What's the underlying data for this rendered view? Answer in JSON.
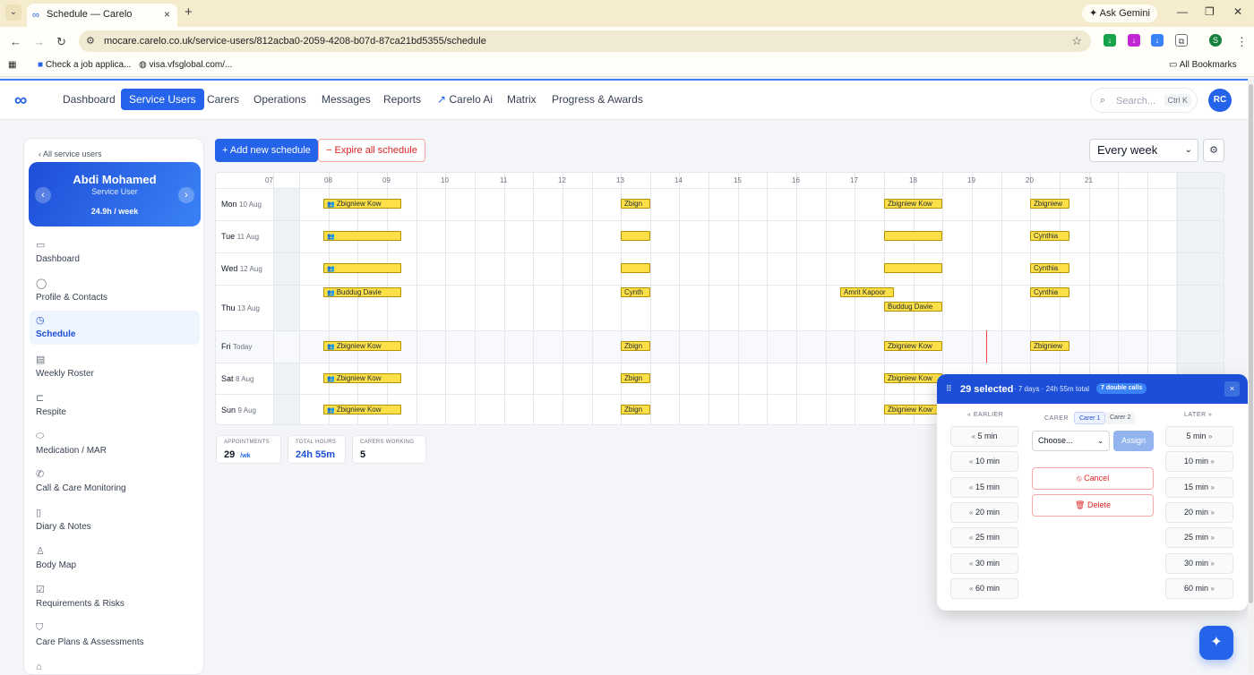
{
  "browser": {
    "tab_title": "Schedule — Carelo",
    "url": "mocare.carelo.co.uk/service-users/812acba0-2059-4208-b07d-87ca21bd5355/schedule",
    "ask_gemini": "Ask Gemini",
    "profile_initial": "S",
    "bookmarks": [
      "Check a job applica...",
      "visa.vfsglobal.com/..."
    ],
    "all_bookmarks": "All Bookmarks"
  },
  "nav": {
    "items": [
      "Dashboard",
      "Service Users",
      "Carers",
      "Operations",
      "Messages",
      "Reports",
      "Carelo Ai",
      "Matrix",
      "Progress & Awards"
    ],
    "active": "Service Users",
    "search_placeholder": "Search...",
    "search_shortcut": "Ctrl K",
    "avatar": "RC"
  },
  "sidebar": {
    "back": "‹ All service users",
    "name": "Abdi Mohamed",
    "role": "Service User",
    "hours": "24.9h / week",
    "items": [
      {
        "label": "Dashboard",
        "icon": "calendar-icon"
      },
      {
        "label": "Profile & Contacts",
        "icon": "user-icon"
      },
      {
        "label": "Schedule",
        "icon": "clock-icon",
        "active": true
      },
      {
        "label": "Weekly Roster",
        "icon": "roster-icon"
      },
      {
        "label": "Respite",
        "icon": "bed-icon"
      },
      {
        "label": "Medication / MAR",
        "icon": "pill-icon"
      },
      {
        "label": "Call & Care Monitoring",
        "icon": "phone-icon"
      },
      {
        "label": "Diary & Notes",
        "icon": "notes-icon"
      },
      {
        "label": "Body Map",
        "icon": "body-icon"
      },
      {
        "label": "Requirements & Risks",
        "icon": "checklist-icon"
      },
      {
        "label": "Care Plans & Assessments",
        "icon": "shield-icon"
      }
    ]
  },
  "toolbar": {
    "add": "+ Add new schedule",
    "expire": "− Expire all schedule",
    "frequency": "Every week"
  },
  "schedule": {
    "hours": [
      "07",
      "08",
      "09",
      "10",
      "11",
      "12",
      "13",
      "14",
      "15",
      "16",
      "17",
      "18",
      "19",
      "20",
      "21"
    ],
    "days": [
      {
        "name": "Mon",
        "date": "10 Aug"
      },
      {
        "name": "Tue",
        "date": "11 Aug"
      },
      {
        "name": "Wed",
        "date": "12 Aug"
      },
      {
        "name": "Thu",
        "date": "13 Aug"
      },
      {
        "name": "Fri",
        "date": "Today"
      },
      {
        "name": "Sat",
        "date": "8 Aug"
      },
      {
        "name": "Sun",
        "date": "9 Aug"
      }
    ],
    "appointments": [
      {
        "day": 0,
        "start": "07:55",
        "end": "09:15",
        "label": "Zbigniew Kow",
        "double": true
      },
      {
        "day": 0,
        "start": "13:00",
        "end": "13:30",
        "label": "Zbign"
      },
      {
        "day": 0,
        "start": "17:30",
        "end": "18:30",
        "label": "Zbigniew Kow"
      },
      {
        "day": 0,
        "start": "20:00",
        "end": "20:40",
        "label": "Zbigniew"
      },
      {
        "day": 1,
        "start": "07:55",
        "end": "09:15",
        "label": "",
        "double": true
      },
      {
        "day": 1,
        "start": "13:00",
        "end": "13:30",
        "label": ""
      },
      {
        "day": 1,
        "start": "17:30",
        "end": "18:30",
        "label": ""
      },
      {
        "day": 1,
        "start": "20:00",
        "end": "20:40",
        "label": "Cynthia"
      },
      {
        "day": 2,
        "start": "07:55",
        "end": "09:15",
        "label": "",
        "double": true
      },
      {
        "day": 2,
        "start": "13:00",
        "end": "13:30",
        "label": ""
      },
      {
        "day": 2,
        "start": "17:30",
        "end": "18:30",
        "label": ""
      },
      {
        "day": 2,
        "start": "20:00",
        "end": "20:40",
        "label": "Cynthia"
      },
      {
        "day": 3,
        "start": "07:55",
        "end": "09:15",
        "label": "Buddug Davie",
        "double": true
      },
      {
        "day": 3,
        "start": "13:00",
        "end": "13:30",
        "label": "Cynth"
      },
      {
        "day": 3,
        "start": "16:45",
        "end": "17:40",
        "label": "Amrit Kapoor"
      },
      {
        "day": 3,
        "start": "17:30",
        "end": "18:30",
        "label": "Buddug Davie",
        "lower": true
      },
      {
        "day": 3,
        "start": "20:00",
        "end": "20:40",
        "label": "Cynthia"
      },
      {
        "day": 4,
        "start": "07:55",
        "end": "09:15",
        "label": "Zbigniew Kow",
        "double": true
      },
      {
        "day": 4,
        "start": "13:00",
        "end": "13:30",
        "label": "Zbign"
      },
      {
        "day": 4,
        "start": "17:30",
        "end": "18:30",
        "label": "Zbigniew Kow"
      },
      {
        "day": 4,
        "start": "20:00",
        "end": "20:40",
        "label": "Zbigniew"
      },
      {
        "day": 5,
        "start": "07:55",
        "end": "09:15",
        "label": "Zbigniew Kow",
        "double": true
      },
      {
        "day": 5,
        "start": "13:00",
        "end": "13:30",
        "label": "Zbign"
      },
      {
        "day": 5,
        "start": "17:30",
        "end": "18:30",
        "label": "Zbigniew Kow"
      },
      {
        "day": 6,
        "start": "07:55",
        "end": "09:15",
        "label": "Zbigniew Kow",
        "double": true
      },
      {
        "day": 6,
        "start": "13:00",
        "end": "13:30",
        "label": "Zbign"
      },
      {
        "day": 6,
        "start": "17:30",
        "end": "18:30",
        "label": "Zbigniew Kow"
      }
    ],
    "now": "19:15"
  },
  "stats": {
    "appointments_label": "APPOINTMENTS",
    "appointments": "29",
    "appointments_unit": "/wk",
    "hours_label": "TOTAL HOURS",
    "hours": "24h 55m",
    "carers_label": "CARERS WORKING",
    "carers": "5"
  },
  "panel": {
    "selected": "29 selected",
    "meta": "· 7 days · 24h 55m total",
    "badge": "7 double calls",
    "close": "×",
    "earlier": "EARLIER",
    "later": "LATER",
    "carer": "CARER",
    "carer_tabs": [
      "Carer 1",
      "Carer 2"
    ],
    "choose": "Choose...",
    "assign": "Assign",
    "cancel": "Cancel",
    "delete": "Delete",
    "shifts": [
      "5 min",
      "10 min",
      "15 min",
      "20 min",
      "25 min",
      "30 min",
      "60 min"
    ]
  }
}
